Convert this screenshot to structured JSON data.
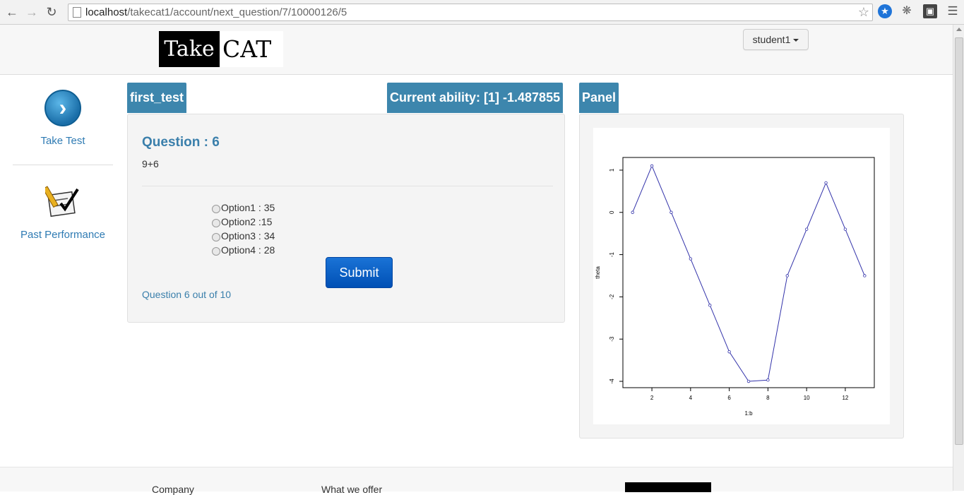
{
  "browser": {
    "url_host": "localhost",
    "url_path": "/takecat1/account/next_question/7/10000126/5"
  },
  "header": {
    "logo_left": "Take",
    "logo_right": "CAT",
    "user_menu_label": "student1"
  },
  "sidebar": {
    "items": [
      {
        "label": "Take Test",
        "icon": "chevron-right-circle-icon"
      },
      {
        "label": "Past Performance",
        "icon": "checklist-pencil-icon"
      }
    ]
  },
  "tabs": {
    "test_name": "first_test",
    "ability": "Current ability: [1] -1.487855",
    "panel": "Panel"
  },
  "question": {
    "title": "Question : 6",
    "text": "9+6",
    "options": [
      {
        "label": "Option1 : 35"
      },
      {
        "label": "Option2 :15"
      },
      {
        "label": "Option3 : 34"
      },
      {
        "label": "Option4 : 28"
      }
    ],
    "submit_label": "Submit",
    "progress": "Question 6 out of 10"
  },
  "chart_data": {
    "type": "line",
    "xlabel": "1:b",
    "ylabel": "theta",
    "x": [
      1,
      2,
      3,
      4,
      5,
      6,
      7,
      8,
      9,
      10,
      11,
      12,
      13
    ],
    "y": [
      0,
      1.1,
      0,
      -1.1,
      -2.2,
      -3.3,
      -4.0,
      -3.97,
      -1.5,
      -0.4,
      0.7,
      -0.4,
      -1.5
    ],
    "xlim": [
      0.5,
      13.5
    ],
    "ylim": [
      -4.15,
      1.3
    ],
    "xticks": [
      "2",
      "4",
      "6",
      "8",
      "10",
      "12"
    ],
    "yticks": [
      "1",
      "0",
      "-1",
      "-2",
      "-3",
      "-4"
    ],
    "line_color": "#3333aa"
  },
  "footer": {
    "col1": "Company",
    "col2": "What we offer"
  }
}
